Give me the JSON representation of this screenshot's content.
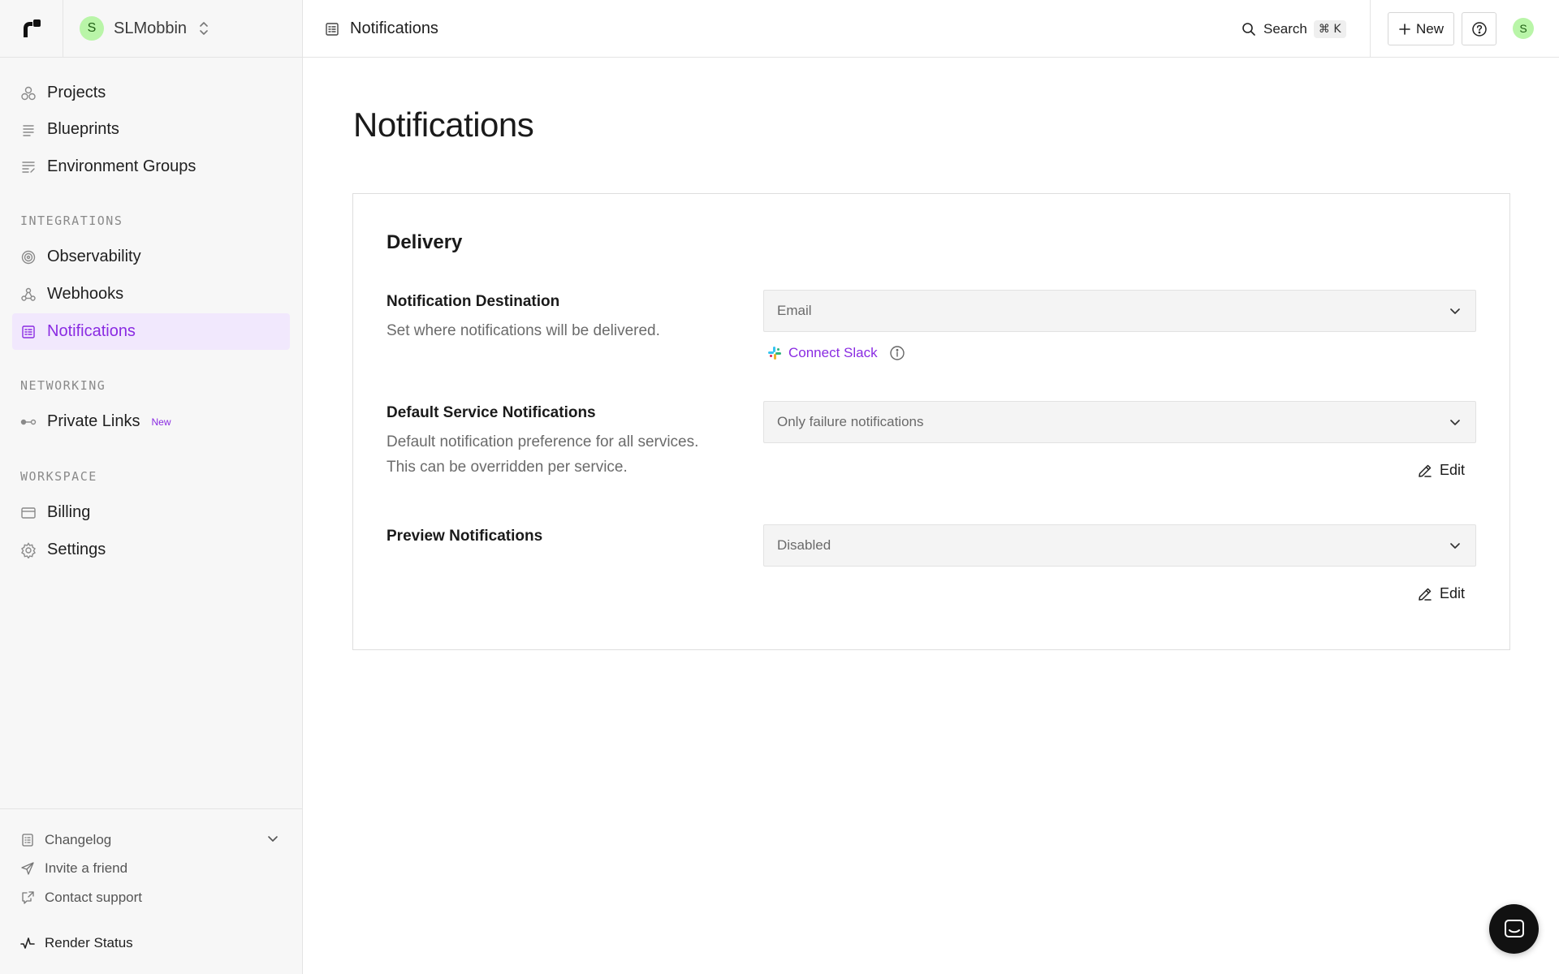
{
  "workspace": {
    "avatar_letter": "S",
    "name": "SLMobbin"
  },
  "sidebar": {
    "primary": [
      {
        "label": "Projects",
        "icon": "projects-icon"
      },
      {
        "label": "Blueprints",
        "icon": "blueprints-icon"
      },
      {
        "label": "Environment Groups",
        "icon": "environment-groups-icon"
      }
    ],
    "integrations_heading": "INTEGRATIONS",
    "integrations": [
      {
        "label": "Observability",
        "icon": "observability-icon"
      },
      {
        "label": "Webhooks",
        "icon": "webhooks-icon"
      },
      {
        "label": "Notifications",
        "icon": "notifications-icon",
        "active": true
      }
    ],
    "networking_heading": "NETWORKING",
    "networking": [
      {
        "label": "Private Links",
        "icon": "private-links-icon",
        "badge": "New"
      }
    ],
    "workspace_heading": "WORKSPACE",
    "workspace_items": [
      {
        "label": "Billing",
        "icon": "billing-icon"
      },
      {
        "label": "Settings",
        "icon": "settings-icon"
      }
    ],
    "footer": [
      {
        "label": "Changelog",
        "icon": "changelog-icon"
      },
      {
        "label": "Invite a friend",
        "icon": "send-icon"
      },
      {
        "label": "Contact support",
        "icon": "external-chat-icon"
      }
    ],
    "status_label": "Render Status"
  },
  "header": {
    "title": "Notifications",
    "search_label": "Search",
    "search_shortcut": "⌘ K",
    "new_label": "New",
    "user_avatar_letter": "S"
  },
  "main": {
    "page_title": "Notifications",
    "card": {
      "title": "Delivery",
      "destination": {
        "title": "Notification Destination",
        "description": "Set where notifications will be delivered.",
        "value": "Email",
        "connect_label": "Connect Slack"
      },
      "default_service": {
        "title": "Default Service Notifications",
        "description_line1": "Default notification preference for all services.",
        "description_line2": "This can be overridden per service.",
        "value": "Only failure notifications",
        "edit_label": "Edit"
      },
      "preview": {
        "title": "Preview Notifications",
        "value": "Disabled",
        "edit_label": "Edit"
      }
    }
  },
  "colors": {
    "accent": "#8a2be2",
    "active_bg": "#f1e8fd",
    "avatar_green": "#b9f5a8"
  }
}
